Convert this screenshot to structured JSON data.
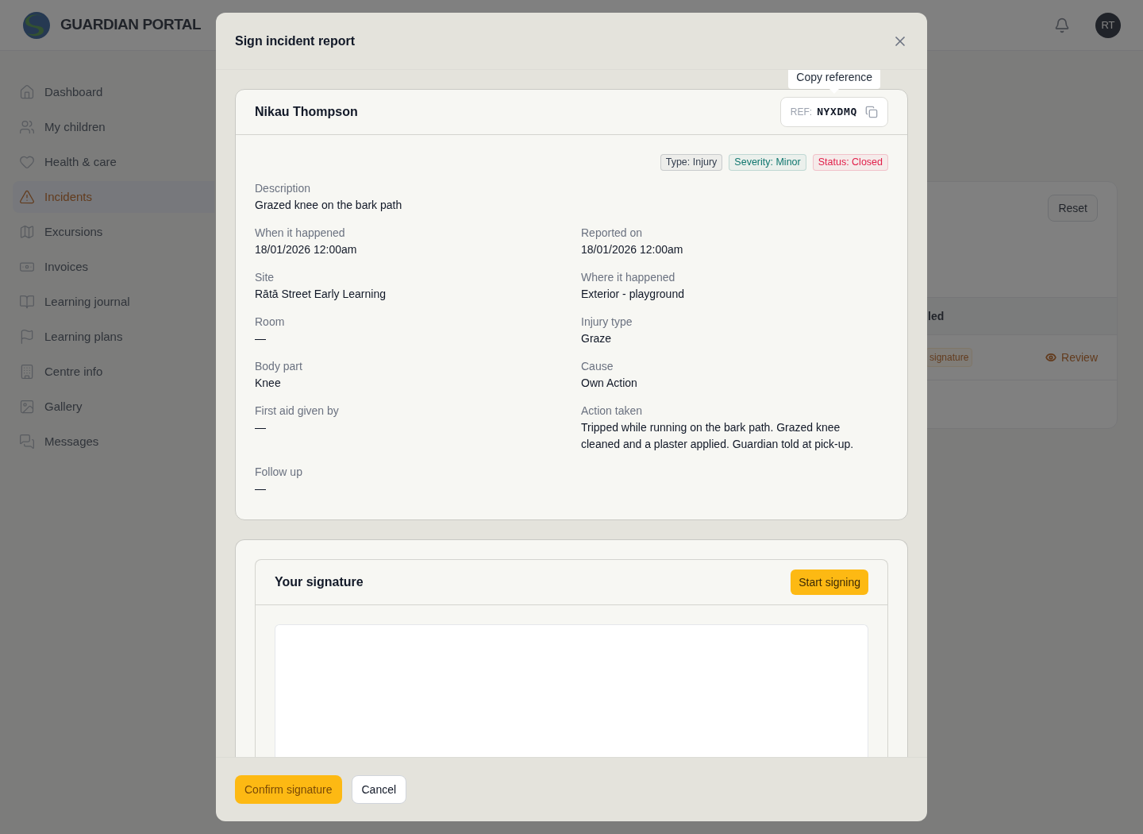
{
  "header": {
    "brand": "GUARDIAN PORTAL",
    "avatar": "RT"
  },
  "sidebar": {
    "items": [
      {
        "label": "Dashboard",
        "selected": false
      },
      {
        "label": "My children",
        "selected": false
      },
      {
        "label": "Health & care",
        "selected": false
      },
      {
        "label": "Incidents",
        "selected": true
      },
      {
        "label": "Excursions",
        "selected": false
      },
      {
        "label": "Invoices",
        "selected": false
      },
      {
        "label": "Learning journal",
        "selected": false
      },
      {
        "label": "Learning plans",
        "selected": false
      },
      {
        "label": "Centre info",
        "selected": false
      },
      {
        "label": "Gallery",
        "selected": false
      },
      {
        "label": "Messages",
        "selected": false
      }
    ]
  },
  "background_card": {
    "reset": "Reset",
    "column_header": "led",
    "badge": "signature",
    "review": "Review"
  },
  "dialog": {
    "title": "Sign incident report",
    "report": {
      "child": "Nikau Thompson",
      "ref_label": "REF:",
      "ref": "NYXDMQ",
      "tooltip": "Copy reference",
      "badges": [
        {
          "label": "Type: Injury",
          "color": "#374151"
        },
        {
          "label": "Severity: Minor",
          "color": "#0f766e"
        },
        {
          "label": "Status: Closed",
          "color": "#e11d48"
        }
      ],
      "description": {
        "label": "Description",
        "value": "Grazed knee on the bark path"
      },
      "fields": [
        {
          "label": "When it happened",
          "value": "18/01/2026 12:00am"
        },
        {
          "label": "Reported on",
          "value": "18/01/2026 12:00am"
        },
        {
          "label": "Site",
          "value": "Rātā Street Early Learning"
        },
        {
          "label": "Where it happened",
          "value": "Exterior - playground"
        },
        {
          "label": "Room",
          "value": "—"
        },
        {
          "label": "Injury type",
          "value": "Graze"
        },
        {
          "label": "Body part",
          "value": "Knee"
        },
        {
          "label": "Cause",
          "value": "Own Action"
        },
        {
          "label": "First aid given by",
          "value": "—"
        },
        {
          "label": "Action taken",
          "value": "Tripped while running on the bark path. Grazed knee cleaned and a plaster applied. Guardian told at pick-up."
        },
        {
          "label": "Follow up",
          "value": "—"
        }
      ]
    },
    "signature": {
      "title": "Your signature",
      "start": "Start signing"
    },
    "buttons": {
      "confirm": "Confirm signature",
      "cancel": "Cancel"
    }
  }
}
